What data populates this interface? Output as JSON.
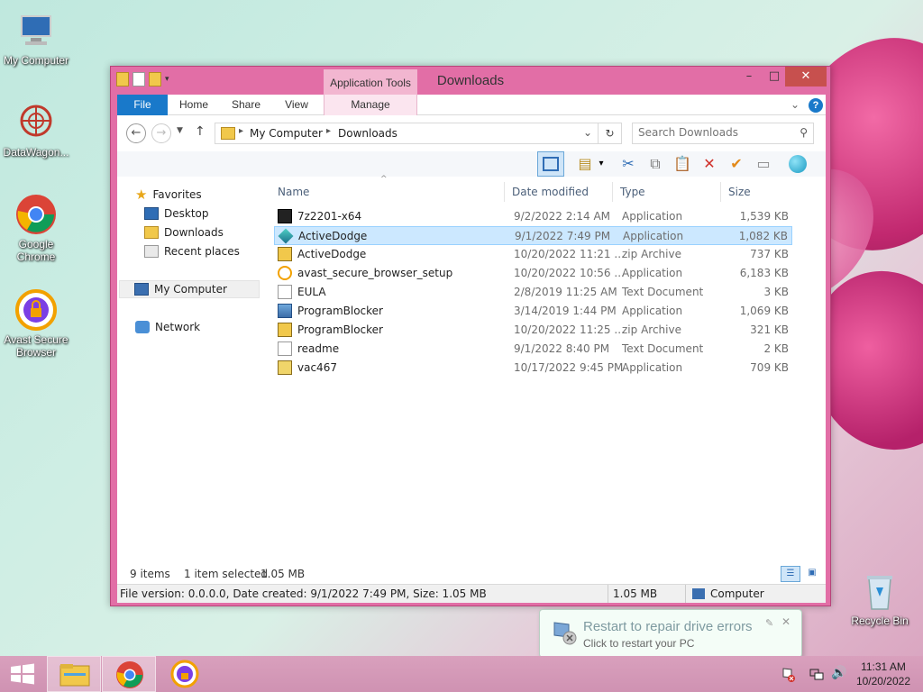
{
  "desktop": {
    "icons": [
      {
        "label": "My Computer"
      },
      {
        "label": "DataWagon..."
      },
      {
        "label": "Google Chrome"
      },
      {
        "label": "Avast Secure Browser"
      },
      {
        "label": "Recycle Bin"
      }
    ]
  },
  "window": {
    "title": "Downloads",
    "contextual_tab_group": "Application Tools",
    "controls": {
      "minimize": "–",
      "maximize": "□",
      "close": "✕"
    }
  },
  "ribbon": {
    "tabs": [
      "File",
      "Home",
      "Share",
      "View",
      "Manage"
    ]
  },
  "address": {
    "crumbs": [
      "My Computer",
      "Downloads"
    ]
  },
  "search": {
    "placeholder": "Search Downloads"
  },
  "nav_pane": {
    "favorites": "Favorites",
    "favorites_items": [
      "Desktop",
      "Downloads",
      "Recent places"
    ],
    "computer": "My Computer",
    "network": "Network"
  },
  "columns": [
    "Name",
    "Date modified",
    "Type",
    "Size"
  ],
  "files": [
    {
      "name": "7z2201-x64",
      "date": "9/2/2022 2:14 AM",
      "type": "Application",
      "size": "1,539 KB",
      "icon": "7zip-installer-icon"
    },
    {
      "name": "ActiveDodge",
      "date": "9/1/2022 7:49 PM",
      "type": "Application",
      "size": "1,082 KB",
      "icon": "diamond-app-icon"
    },
    {
      "name": "ActiveDodge",
      "date": "10/20/2022 11:21 ...",
      "type": "zip Archive",
      "size": "737 KB",
      "icon": "zip-icon"
    },
    {
      "name": "avast_secure_browser_setup",
      "date": "10/20/2022 10:56 ...",
      "type": "Application",
      "size": "6,183 KB",
      "icon": "avast-setup-icon"
    },
    {
      "name": "EULA",
      "date": "2/8/2019 11:25 AM",
      "type": "Text Document",
      "size": "3 KB",
      "icon": "text-file-icon"
    },
    {
      "name": "ProgramBlocker",
      "date": "3/14/2019 1:44 PM",
      "type": "Application",
      "size": "1,069 KB",
      "icon": "program-blocker-icon"
    },
    {
      "name": "ProgramBlocker",
      "date": "10/20/2022 11:25 ...",
      "type": "zip Archive",
      "size": "321 KB",
      "icon": "zip-icon"
    },
    {
      "name": "readme",
      "date": "9/1/2022 8:40 PM",
      "type": "Text Document",
      "size": "2 KB",
      "icon": "text-file-icon"
    },
    {
      "name": "vac467",
      "date": "10/17/2022 9:45 PM",
      "type": "Application",
      "size": "709 KB",
      "icon": "installer-icon"
    }
  ],
  "selected_index": 1,
  "status": {
    "items": "9 items",
    "selected": "1 item selected",
    "selected_size": "1.05 MB"
  },
  "details": {
    "info": "File version: 0.0.0.0, Date created: 9/1/2022 7:49 PM, Size: 1.05 MB",
    "size": "1.05 MB",
    "location": "Computer"
  },
  "notification": {
    "title": "Restart to repair drive errors",
    "subtitle": "Click to restart your PC"
  },
  "clock": {
    "time": "11:31 AM",
    "date": "10/20/2022"
  },
  "colors": {
    "accent": "#1979ca",
    "window_frame": "#e26ea6",
    "selection": "#cce8ff"
  }
}
